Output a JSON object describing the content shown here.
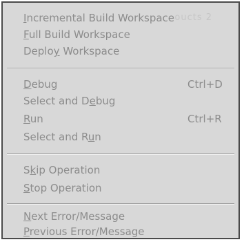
{
  "menu": {
    "background_text": "oucts 2",
    "items": [
      {
        "pre": "",
        "u": "I",
        "post": "ncremental Build Workspace",
        "shortcut": ""
      },
      {
        "pre": "",
        "u": "F",
        "post": "ull Build Workspace",
        "shortcut": ""
      },
      {
        "pre": "Deplo",
        "u": "y",
        "post": " Workspace",
        "shortcut": ""
      },
      {
        "pre": "",
        "u": "D",
        "post": "ebug",
        "shortcut": "Ctrl+D"
      },
      {
        "pre": "Select and D",
        "u": "e",
        "post": "bug",
        "shortcut": ""
      },
      {
        "pre": "",
        "u": "R",
        "post": "un",
        "shortcut": "Ctrl+R"
      },
      {
        "pre": "Select and R",
        "u": "u",
        "post": "n",
        "shortcut": ""
      },
      {
        "pre": "S",
        "u": "k",
        "post": "ip Operation",
        "shortcut": ""
      },
      {
        "pre": "",
        "u": "S",
        "post": "top Operation",
        "shortcut": ""
      },
      {
        "pre": "",
        "u": "N",
        "post": "ext Error/Message",
        "shortcut": ""
      },
      {
        "pre": "",
        "u": "P",
        "post": "revious Error/Message",
        "shortcut": ""
      }
    ]
  }
}
